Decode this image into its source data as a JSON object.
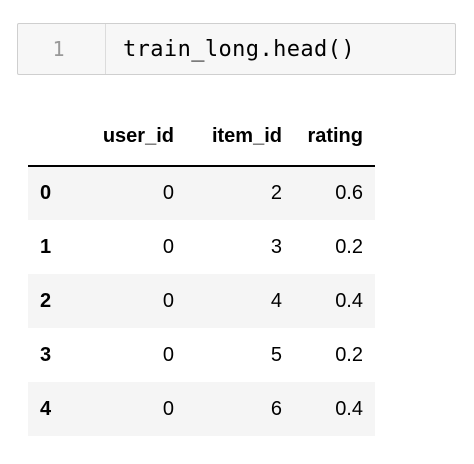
{
  "code_cell": {
    "line_number": "1",
    "code": "train_long.head()"
  },
  "output": {
    "columns": [
      "user_id",
      "item_id",
      "rating"
    ],
    "rows": [
      {
        "index": "0",
        "user_id": "0",
        "item_id": "2",
        "rating": "0.6"
      },
      {
        "index": "1",
        "user_id": "0",
        "item_id": "3",
        "rating": "0.2"
      },
      {
        "index": "2",
        "user_id": "0",
        "item_id": "4",
        "rating": "0.4"
      },
      {
        "index": "3",
        "user_id": "0",
        "item_id": "5",
        "rating": "0.2"
      },
      {
        "index": "4",
        "user_id": "0",
        "item_id": "6",
        "rating": "0.4"
      }
    ]
  }
}
